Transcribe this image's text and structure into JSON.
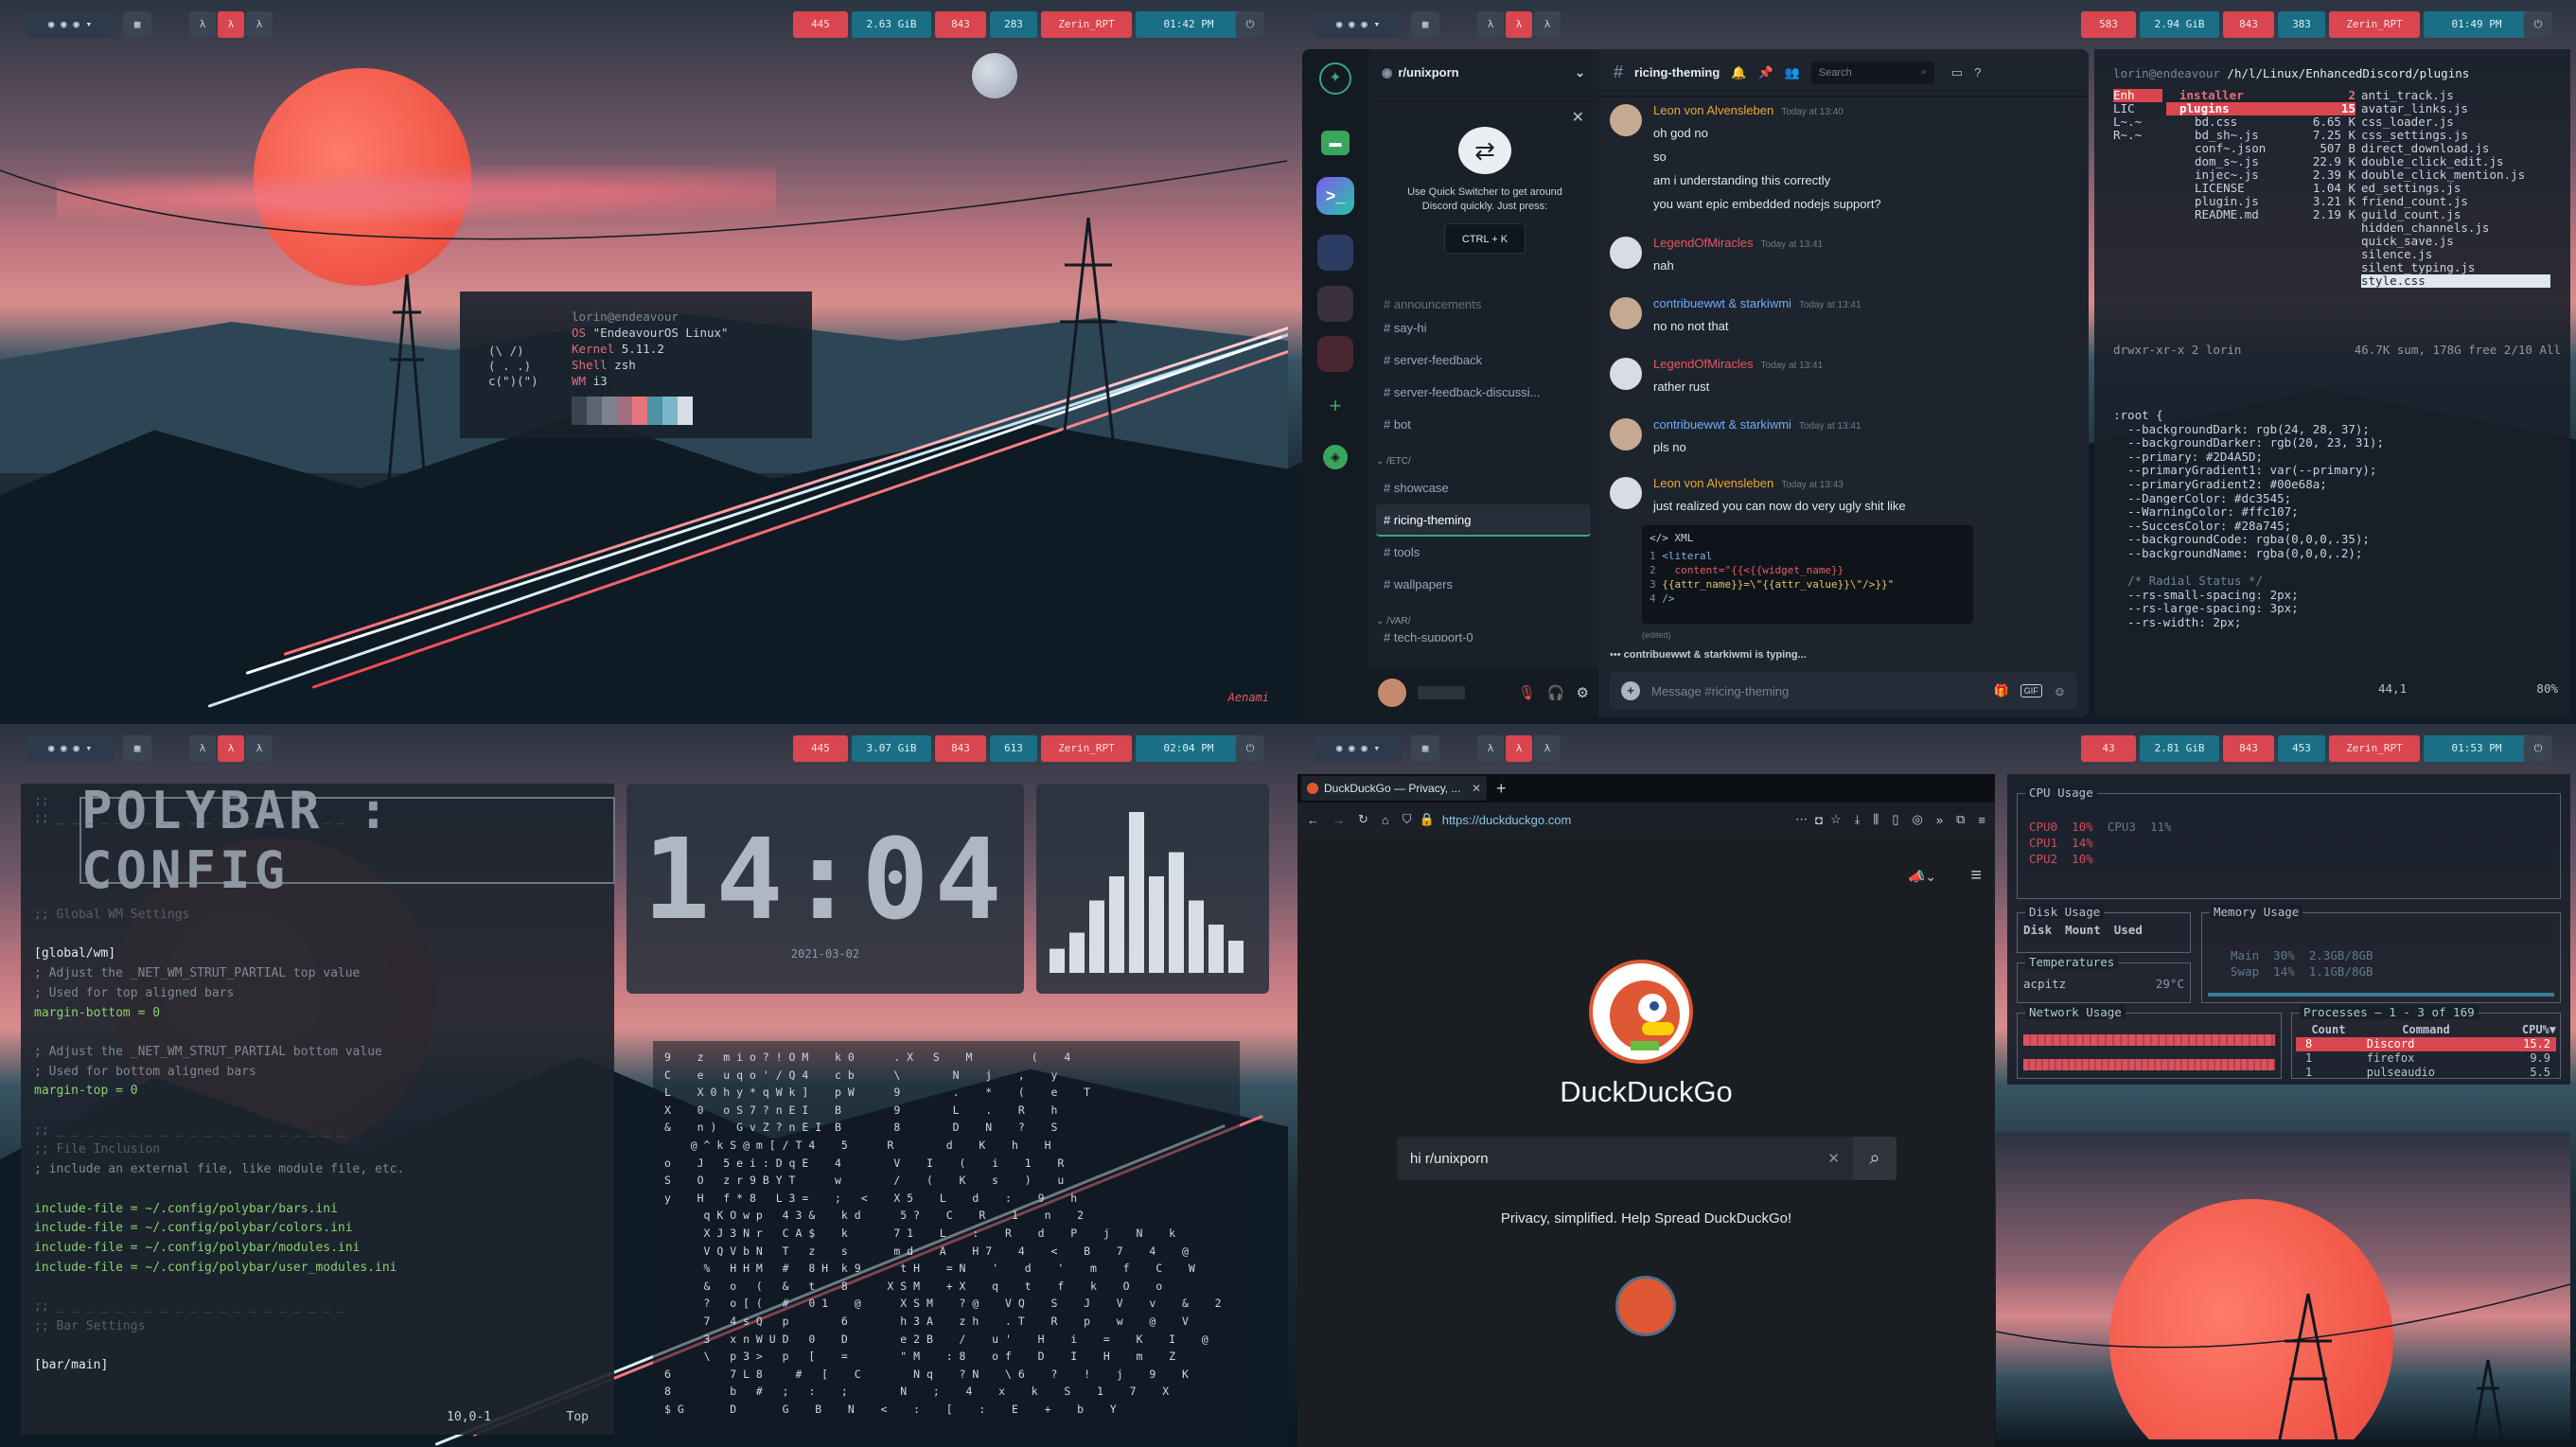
{
  "bars": {
    "q1": {
      "net": "445",
      "ram": "2.63 GiB",
      "vol": "843",
      "bat": "283",
      "user": "Zerin_RPT",
      "time": "01:42 PM"
    },
    "q2": {
      "net": "583",
      "ram": "2.94 GiB",
      "vol": "843",
      "bat": "383",
      "user": "Zerin_RPT",
      "time": "01:49 PM"
    },
    "q3": {
      "net": "445",
      "ram": "3.07 GiB",
      "vol": "843",
      "bat": "613",
      "user": "Zerin_RPT",
      "time": "02:04 PM"
    },
    "q4": {
      "net": "43",
      "ram": "2.81 GiB",
      "vol": "843",
      "bat": "453",
      "user": "Zerin_RPT",
      "time": "01:53 PM"
    },
    "ws_glyph": "λ"
  },
  "neofetch": {
    "user": "lorin@endeavour",
    "ascii": [
      "(\\ /)",
      "( . .)",
      "c(\")(\")"
    ],
    "rows": [
      {
        "k": "OS",
        "v": "\"EndeavourOS Linux\""
      },
      {
        "k": "Kernel",
        "v": "5.11.2"
      },
      {
        "k": "Shell",
        "v": "zsh"
      },
      {
        "k": "WM",
        "v": "i3"
      }
    ],
    "palette": [
      "#3b4250",
      "#5d6472",
      "#7b8290",
      "#a26d7d",
      "#e8747b",
      "#4d92a5",
      "#7ab7c8",
      "#d8dee6"
    ]
  },
  "signature": "Aenami",
  "discord": {
    "server": "r/unixporn",
    "channel": "ricing-theming",
    "search_placeholder": "Search",
    "popup_text": "Use Quick Switcher to get around Discord quickly. Just press:",
    "popup_key": "CTRL + K",
    "cut_channel": "announcements",
    "channels1": [
      "say-hi",
      "server-feedback",
      "server-feedback-discussi...",
      "bot"
    ],
    "cat_etc": "/ETC/",
    "channels2": [
      "showcase",
      "ricing-theming",
      "tools",
      "wallpapers"
    ],
    "cat_var": "/VAR/",
    "channel_cut2": "tech-support-0",
    "messages": [
      {
        "author": "Leon von Alvensleben",
        "color": "#f0a62f",
        "time": "Today at 13:40",
        "lines": [
          "oh god no",
          "so",
          "am i understanding this correctly",
          "you want epic embedded nodejs support?"
        ]
      },
      {
        "author": "LegendOfMiracles",
        "color": "#e9555f",
        "time": "Today at 13:41",
        "lines": [
          "nah"
        ]
      },
      {
        "author": "contribuewwt & starkiwmi",
        "color": "#6eaef5",
        "time": "Today at 13:41",
        "lines": [
          "no no not that"
        ]
      },
      {
        "author": "LegendOfMiracles",
        "color": "#e9555f",
        "time": "Today at 13:41",
        "lines": [
          "rather rust"
        ]
      },
      {
        "author": "contribuewwt & starkiwmi",
        "color": "#6eaef5",
        "time": "Today at 13:41",
        "lines": [
          "pls no"
        ]
      },
      {
        "author": "Leon von Alvensleben",
        "color": "#f0a62f",
        "time": "Today at 13:43",
        "lines": [
          "just realized you can now do very ugly shit like"
        ]
      }
    ],
    "code_lang": "XML",
    "code": [
      "<literal",
      "  content=\"{{<{{widget_name}}",
      "{{attr_name}}=\\\"{{attr_value}}\\\"/>}}\"",
      "/>"
    ],
    "edited": "(edited)",
    "typing": "contribuewwt & starkiwmi is typing...",
    "input_placeholder": "Message #ricing-theming",
    "gif": "GIF"
  },
  "ranger": {
    "path_user": "lorin@endeavour",
    "path": " /h/l/Linux/EnhancedDiscord/plugins",
    "col1": [
      "Enh",
      "LIC",
      "L~.~",
      "R~.~"
    ],
    "col2": [
      [
        "installer",
        "2"
      ],
      [
        "plugins",
        "15"
      ],
      [
        "bd.css",
        "6.65 K"
      ],
      [
        "bd_sh~.js",
        "7.25 K"
      ],
      [
        "conf~.json",
        "507 B"
      ],
      [
        "dom_s~.js",
        "22.9 K"
      ],
      [
        "injec~.js",
        "2.39 K"
      ],
      [
        "LICENSE",
        "1.04 K"
      ],
      [
        "plugin.js",
        "3.21 K"
      ],
      [
        "README.md",
        "2.19 K"
      ]
    ],
    "col3": [
      "anti_track.js",
      "avatar_links.js",
      "css_loader.js",
      "css_settings.js",
      "direct_download.js",
      "double_click_edit.js",
      "double_click_mention.js",
      "ed_settings.js",
      "friend_count.js",
      "guild_count.js",
      "hidden_channels.js",
      "quick_save.js",
      "silence.js",
      "silent_typing.js",
      "style.css"
    ],
    "status": "drwxr-xr-x 2 lorin",
    "status_r": "46.7K sum, 178G free  2/10  All"
  },
  "css": {
    "lines": [
      ":root {",
      "  --backgroundDark: rgb(24, 28, 37);",
      "  --backgroundDarker: rgb(20, 23, 31);",
      "  --primary: #2D4A5D;",
      "  --primaryGradient1: var(--primary);",
      "  --primaryGradient2: #00e68a;",
      "  --DangerColor: #dc3545;",
      "  --WarningColor: #ffc107;",
      "  --SuccesColor: #28a745;",
      "  --backgroundCode: rgba(0,0,0,.35);",
      "  --backgroundName: rgba(0,0,0,.2);",
      "",
      "  /* Radial Status */",
      "  --rs-small-spacing: 2px;",
      "  --rs-large-spacing: 3px;",
      "  --rs-width: 2px;"
    ],
    "pos": "44,1",
    "pct": "80%"
  },
  "polybar": {
    "title": "POLYBAR : CONFIG",
    "lines": [
      ";;",
      ";; _ _ _ _ _ _ _ _ _ _ _ _ _ _ _ _ _ _ _ _",
      ";; Global WM Settings",
      "",
      "[global/wm]",
      "; Adjust the _NET_WM_STRUT_PARTIAL top value",
      "; Used for top aligned bars",
      "margin-bottom = 0",
      "",
      "; Adjust the _NET_WM_STRUT_PARTIAL bottom value",
      "; Used for bottom aligned bars",
      "margin-top = 0",
      "",
      ";; _ _ _ _ _ _ _ _ _ _ _ _ _ _ _ _ _ _ _ _",
      ";; File Inclusion",
      "; include an external file, like module file, etc.",
      "",
      "include-file = ~/.config/polybar/bars.ini",
      "include-file = ~/.config/polybar/colors.ini",
      "include-file = ~/.config/polybar/modules.ini",
      "include-file = ~/.config/polybar/user_modules.ini",
      "",
      ";; _ _ _ _ _ _ _ _ _ _ _ _ _ _ _ _ _ _ _ _",
      ";; Bar Settings",
      "",
      "[bar/main]"
    ],
    "pos": "10,0-1",
    "top": "Top"
  },
  "clock": {
    "time": "14:04",
    "date": "2021-03-02"
  },
  "visualizer": [
    0.15,
    0.25,
    0.45,
    0.6,
    1.0,
    0.6,
    0.75,
    0.45,
    0.3,
    0.2
  ],
  "matrix": [
    "9    z   m i o ? ! O M    k 0      . X   S    M         (    4",
    "C    e   u q o ' / Q 4    c b      \\        N    j    ,    y",
    "L    X 0 h y * q W k ]    p W      9        .    *    (    e    T",
    "X    0   o S 7 ? n E I    B        9        L    .    R    h",
    "&    n )   G v Z ? n E I  B        8        D    N    ?    S",
    "    @ ^ k S @ m [ / T 4    5      R        d    K    h    H",
    "o    J   5 e i : D q E    4        V    I    (    i    1    R",
    "S    O   z r 9 B Y T      w        /    (    K    s    )    u",
    "y    H   f * 8   L 3 =    ;   <    X 5    L    d    :    9    h",
    "      q K O w p   4 3 &    k d      5 ?    C    R    1    n    2",
    "      X J 3 N r   C A $    k       7 1    L    :    R    d    P    j    N    k",
    "      V Q V b N   T   z    s       m d    A    H 7    4    <    B    7    4    @",
    "      %   H H M   #   8 H  k 9      t H    = N    '    d    '    m    f    C    W",
    "      &   o   (   &   t    8      X S M    + X    q    t    f    k    O    o",
    "      ?   o [ (   #   0 1    @      X S M    ? @    V Q    S    J    V    v    &    2",
    "      7   4 s Q   p        6        h 3 A    z h    . T    R    p    w    @    V",
    "      3   x n W U D   0    D        e 2 B    /    u '    H    i    =    K    I    @",
    "      \\   p 3 >   p   [    =        \" M    : 8    o f    D    I    H    m    Z",
    "6         7 L 8     #   [    C        N q    ? N    \\ 6    ?    !    j    9    K",
    "8         b   #   ;   :    ;        N    ;    4    x    k    S    1    7    X",
    "$ G       D       G    B    N    <    :    [    :    E    +    b    Y"
  ],
  "firefox": {
    "tab": "DuckDuckGo — Privacy, ...",
    "url": "https://duckduckgo.com",
    "brand": "DuckDuckGo",
    "query": "hi r/unixporn",
    "tagline": "Privacy, simplified. Help Spread DuckDuckGo!"
  },
  "btop": {
    "cpu_title": "CPU Usage",
    "cpu_rows": [
      {
        "l": "CPU0",
        "v": "10%",
        "l2": "CPU3",
        "v2": "11%"
      },
      {
        "l": "CPU1",
        "v": "14%"
      },
      {
        "l": "CPU2",
        "v": "10%"
      }
    ],
    "disk_title": "Disk Usage",
    "disk_cols": [
      "Disk",
      "Mount",
      "Used"
    ],
    "temp_title": "Temperatures",
    "temp": {
      "name": "acpitz",
      "val": "29°C"
    },
    "mem_title": "Memory Usage",
    "mem_rows": [
      {
        "l": "Main",
        "p": "30%",
        "v": "2.3GB/8GB"
      },
      {
        "l": "Swap",
        "p": "14%",
        "v": "1.1GB/8GB"
      }
    ],
    "net_title": "Network Usage",
    "proc_title": "Processes",
    "proc_range": "1 - 3 of 169",
    "proc_cols": [
      "Count",
      "Command",
      "CPU%▼"
    ],
    "procs": [
      {
        "c": "8",
        "n": "Discord",
        "p": "15.2"
      },
      {
        "c": "1",
        "n": "firefox",
        "p": "9.9"
      },
      {
        "c": "1",
        "n": "pulseaudio",
        "p": "5.5"
      }
    ]
  }
}
